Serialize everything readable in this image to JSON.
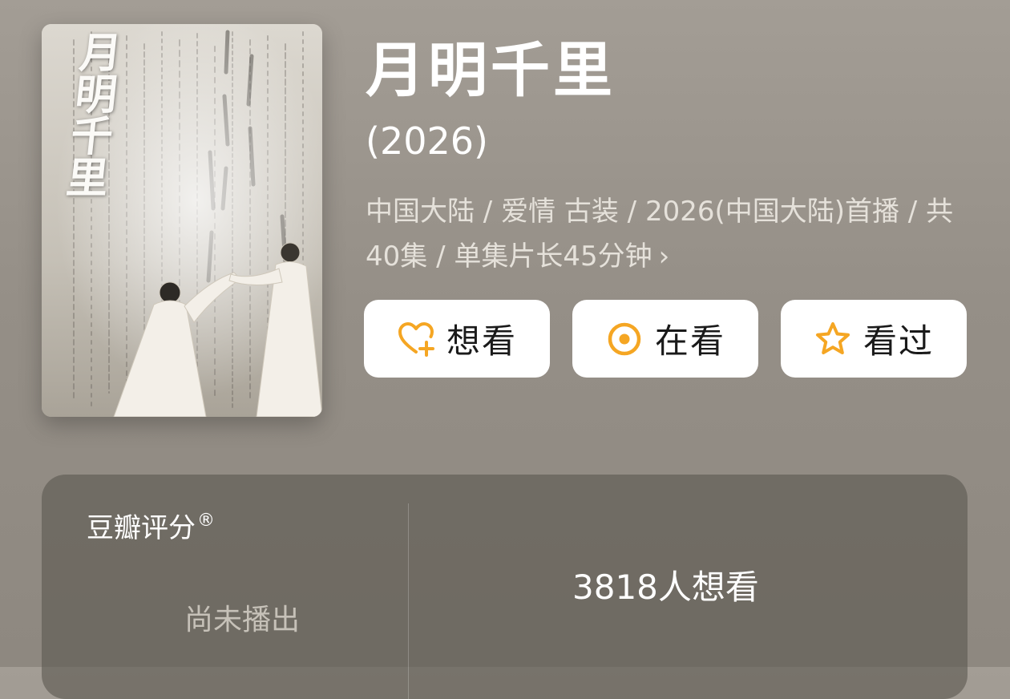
{
  "poster": {
    "title": "月明千里",
    "alt": "poster"
  },
  "title": "月明千里",
  "year": "(2026)",
  "meta": {
    "text": "中国大陆 / 爱情 古装 / 2026(中国大陆)首播 / 共40集 / 单集片长45分钟",
    "chevron": "›"
  },
  "actions": [
    {
      "label": "想看",
      "icon": "heart-plus-icon",
      "color": "#f5a623"
    },
    {
      "label": "在看",
      "icon": "circle-dot-icon",
      "color": "#f5a623"
    },
    {
      "label": "看过",
      "icon": "star-outline-icon",
      "color": "#f5a623"
    }
  ],
  "rating": {
    "title": "豆瓣评分",
    "registered_mark": "®",
    "status": "尚未播出",
    "want_count": "3818人想看"
  }
}
